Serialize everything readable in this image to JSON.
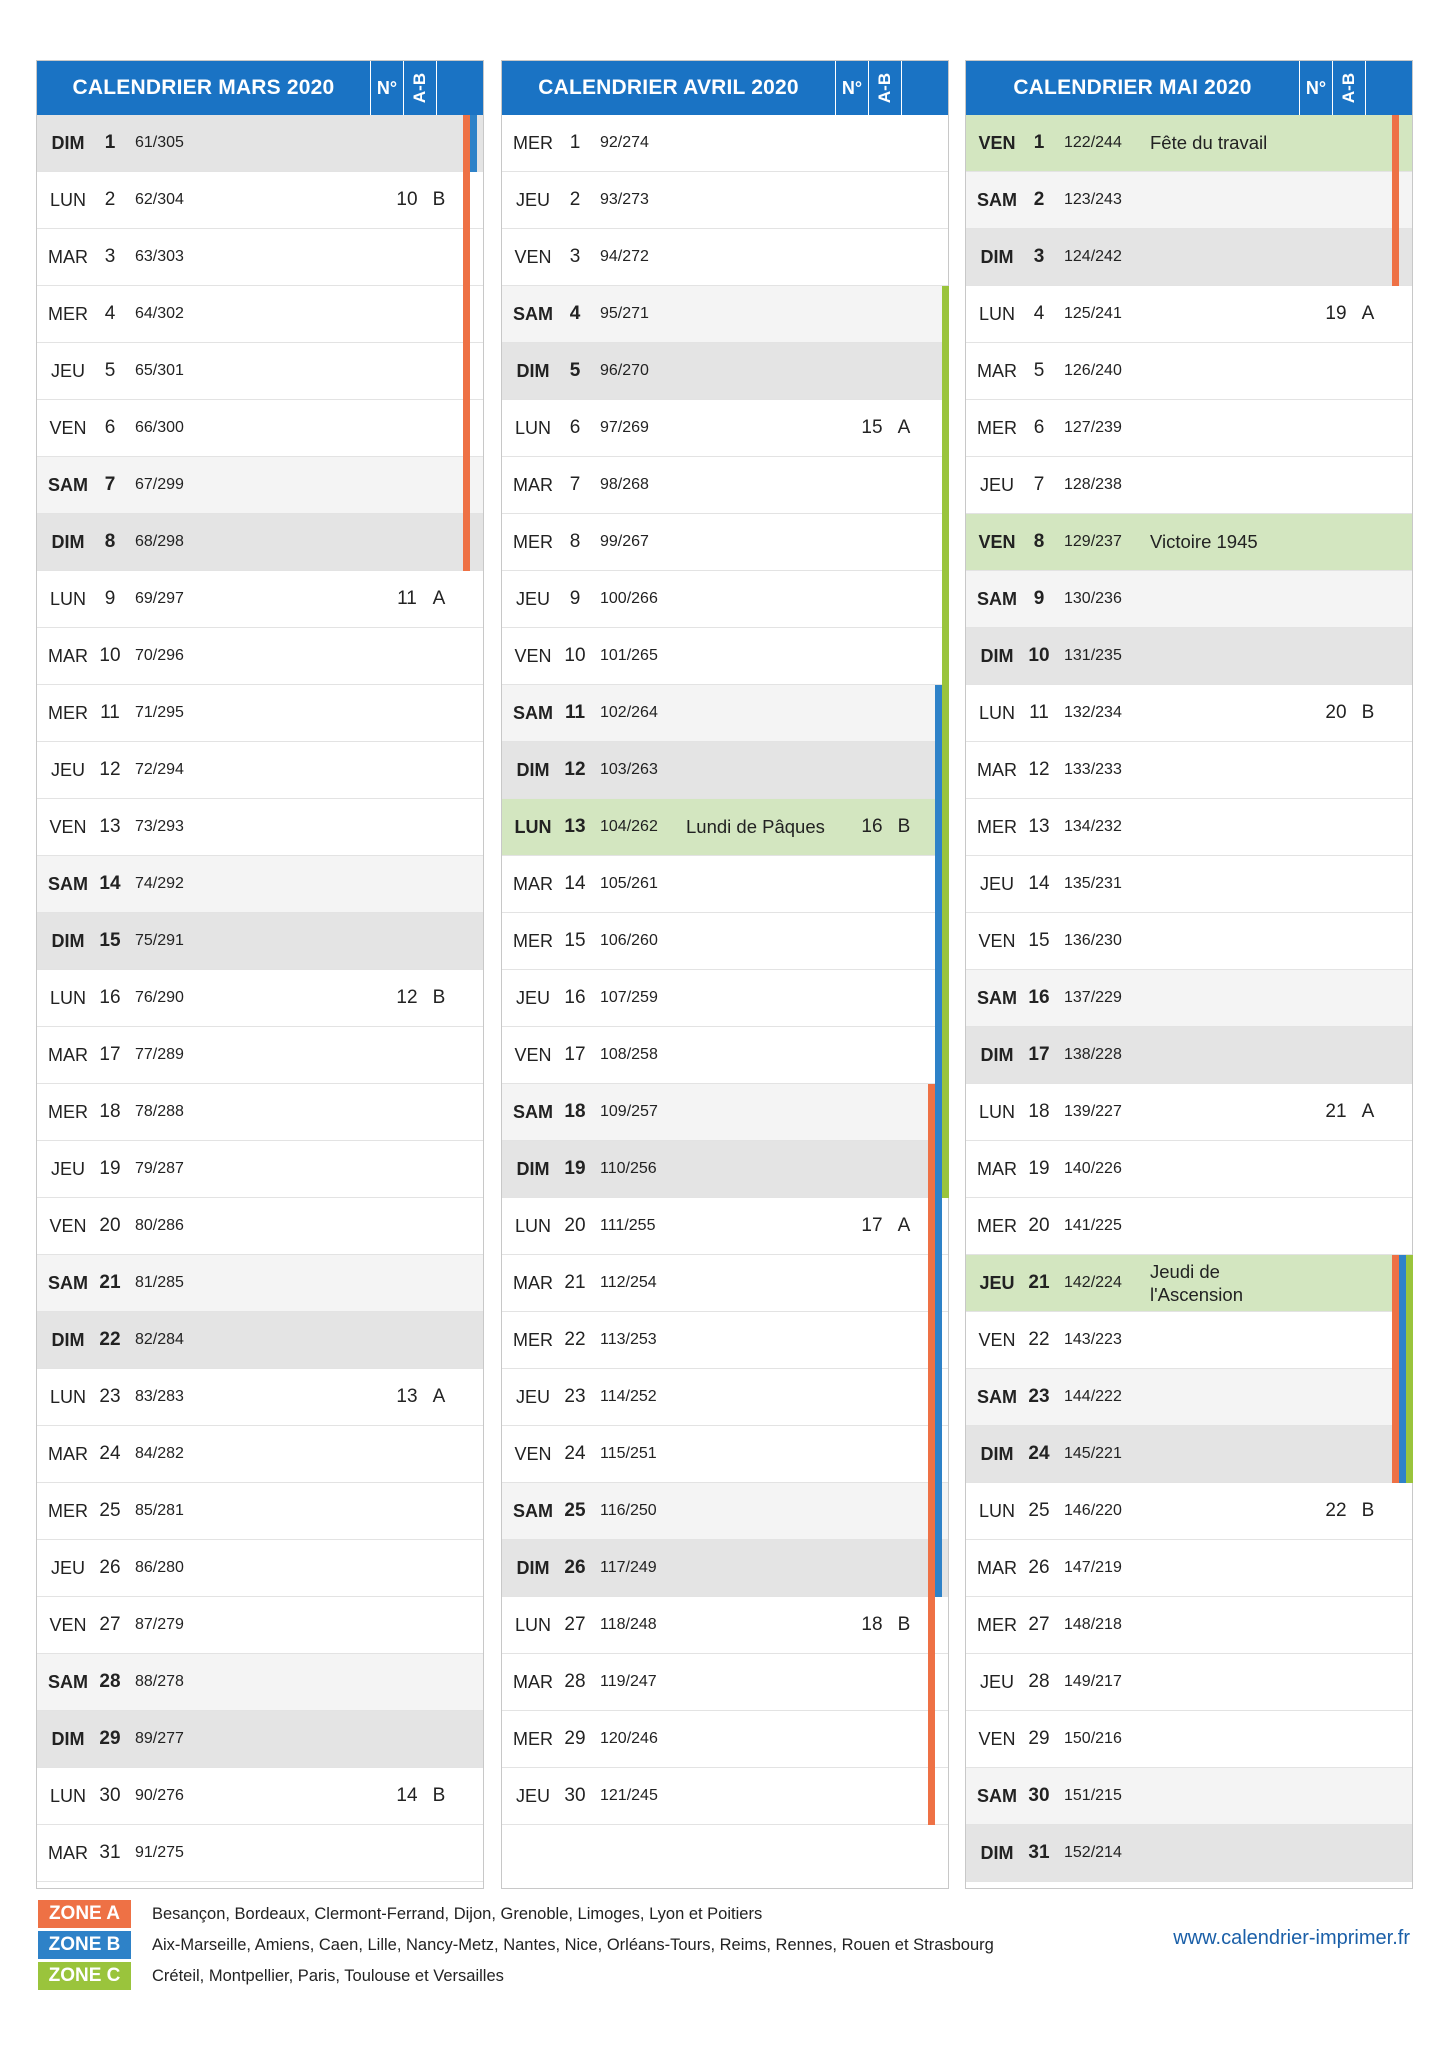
{
  "colors": {
    "header": "#1a73c4",
    "zone_a": "#ee7145",
    "zone_b": "#2e82c8",
    "zone_c": "#9ac43c",
    "holiday_bg": "#d3e6c0"
  },
  "header_no_label": "N°",
  "header_ab_label": "A-B",
  "months": [
    {
      "title": "CALENDRIER MARS 2020",
      "days": [
        {
          "dn": "DIM",
          "d": "1",
          "yd": "61/305",
          "zones": [
            "A",
            "B"
          ]
        },
        {
          "dn": "LUN",
          "d": "2",
          "yd": "62/304",
          "wk": "10",
          "ab": "B",
          "zones": [
            "A"
          ]
        },
        {
          "dn": "MAR",
          "d": "3",
          "yd": "63/303",
          "zones": [
            "A"
          ]
        },
        {
          "dn": "MER",
          "d": "4",
          "yd": "64/302",
          "zones": [
            "A"
          ]
        },
        {
          "dn": "JEU",
          "d": "5",
          "yd": "65/301",
          "zones": [
            "A"
          ]
        },
        {
          "dn": "VEN",
          "d": "6",
          "yd": "66/300",
          "zones": [
            "A"
          ]
        },
        {
          "dn": "SAM",
          "d": "7",
          "yd": "67/299",
          "zones": [
            "A"
          ]
        },
        {
          "dn": "DIM",
          "d": "8",
          "yd": "68/298",
          "zones": [
            "A"
          ]
        },
        {
          "dn": "LUN",
          "d": "9",
          "yd": "69/297",
          "wk": "11",
          "ab": "A"
        },
        {
          "dn": "MAR",
          "d": "10",
          "yd": "70/296"
        },
        {
          "dn": "MER",
          "d": "11",
          "yd": "71/295"
        },
        {
          "dn": "JEU",
          "d": "12",
          "yd": "72/294"
        },
        {
          "dn": "VEN",
          "d": "13",
          "yd": "73/293"
        },
        {
          "dn": "SAM",
          "d": "14",
          "yd": "74/292"
        },
        {
          "dn": "DIM",
          "d": "15",
          "yd": "75/291"
        },
        {
          "dn": "LUN",
          "d": "16",
          "yd": "76/290",
          "wk": "12",
          "ab": "B"
        },
        {
          "dn": "MAR",
          "d": "17",
          "yd": "77/289"
        },
        {
          "dn": "MER",
          "d": "18",
          "yd": "78/288"
        },
        {
          "dn": "JEU",
          "d": "19",
          "yd": "79/287"
        },
        {
          "dn": "VEN",
          "d": "20",
          "yd": "80/286"
        },
        {
          "dn": "SAM",
          "d": "21",
          "yd": "81/285"
        },
        {
          "dn": "DIM",
          "d": "22",
          "yd": "82/284"
        },
        {
          "dn": "LUN",
          "d": "23",
          "yd": "83/283",
          "wk": "13",
          "ab": "A"
        },
        {
          "dn": "MAR",
          "d": "24",
          "yd": "84/282"
        },
        {
          "dn": "MER",
          "d": "25",
          "yd": "85/281"
        },
        {
          "dn": "JEU",
          "d": "26",
          "yd": "86/280"
        },
        {
          "dn": "VEN",
          "d": "27",
          "yd": "87/279"
        },
        {
          "dn": "SAM",
          "d": "28",
          "yd": "88/278"
        },
        {
          "dn": "DIM",
          "d": "29",
          "yd": "89/277"
        },
        {
          "dn": "LUN",
          "d": "30",
          "yd": "90/276",
          "wk": "14",
          "ab": "B"
        },
        {
          "dn": "MAR",
          "d": "31",
          "yd": "91/275"
        }
      ]
    },
    {
      "title": "CALENDRIER AVRIL 2020",
      "days": [
        {
          "dn": "MER",
          "d": "1",
          "yd": "92/274"
        },
        {
          "dn": "JEU",
          "d": "2",
          "yd": "93/273"
        },
        {
          "dn": "VEN",
          "d": "3",
          "yd": "94/272"
        },
        {
          "dn": "SAM",
          "d": "4",
          "yd": "95/271",
          "zones": [
            "C"
          ]
        },
        {
          "dn": "DIM",
          "d": "5",
          "yd": "96/270",
          "zones": [
            "C"
          ]
        },
        {
          "dn": "LUN",
          "d": "6",
          "yd": "97/269",
          "wk": "15",
          "ab": "A",
          "zones": [
            "C"
          ]
        },
        {
          "dn": "MAR",
          "d": "7",
          "yd": "98/268",
          "zones": [
            "C"
          ]
        },
        {
          "dn": "MER",
          "d": "8",
          "yd": "99/267",
          "zones": [
            "C"
          ]
        },
        {
          "dn": "JEU",
          "d": "9",
          "yd": "100/266",
          "zones": [
            "C"
          ]
        },
        {
          "dn": "VEN",
          "d": "10",
          "yd": "101/265",
          "zones": [
            "C"
          ]
        },
        {
          "dn": "SAM",
          "d": "11",
          "yd": "102/264",
          "zones": [
            "B",
            "C"
          ]
        },
        {
          "dn": "DIM",
          "d": "12",
          "yd": "103/263",
          "zones": [
            "B",
            "C"
          ]
        },
        {
          "dn": "LUN",
          "d": "13",
          "yd": "104/262",
          "hol": "Lundi de Pâques",
          "wk": "16",
          "ab": "B",
          "zones": [
            "B",
            "C"
          ]
        },
        {
          "dn": "MAR",
          "d": "14",
          "yd": "105/261",
          "zones": [
            "B",
            "C"
          ]
        },
        {
          "dn": "MER",
          "d": "15",
          "yd": "106/260",
          "zones": [
            "B",
            "C"
          ]
        },
        {
          "dn": "JEU",
          "d": "16",
          "yd": "107/259",
          "zones": [
            "B",
            "C"
          ]
        },
        {
          "dn": "VEN",
          "d": "17",
          "yd": "108/258",
          "zones": [
            "B",
            "C"
          ]
        },
        {
          "dn": "SAM",
          "d": "18",
          "yd": "109/257",
          "zones": [
            "A",
            "B",
            "C"
          ]
        },
        {
          "dn": "DIM",
          "d": "19",
          "yd": "110/256",
          "zones": [
            "A",
            "B",
            "C"
          ]
        },
        {
          "dn": "LUN",
          "d": "20",
          "yd": "111/255",
          "wk": "17",
          "ab": "A",
          "zones": [
            "A",
            "B"
          ]
        },
        {
          "dn": "MAR",
          "d": "21",
          "yd": "112/254",
          "zones": [
            "A",
            "B"
          ]
        },
        {
          "dn": "MER",
          "d": "22",
          "yd": "113/253",
          "zones": [
            "A",
            "B"
          ]
        },
        {
          "dn": "JEU",
          "d": "23",
          "yd": "114/252",
          "zones": [
            "A",
            "B"
          ]
        },
        {
          "dn": "VEN",
          "d": "24",
          "yd": "115/251",
          "zones": [
            "A",
            "B"
          ]
        },
        {
          "dn": "SAM",
          "d": "25",
          "yd": "116/250",
          "zones": [
            "A",
            "B"
          ]
        },
        {
          "dn": "DIM",
          "d": "26",
          "yd": "117/249",
          "zones": [
            "A",
            "B"
          ]
        },
        {
          "dn": "LUN",
          "d": "27",
          "yd": "118/248",
          "wk": "18",
          "ab": "B",
          "zones": [
            "A"
          ]
        },
        {
          "dn": "MAR",
          "d": "28",
          "yd": "119/247",
          "zones": [
            "A"
          ]
        },
        {
          "dn": "MER",
          "d": "29",
          "yd": "120/246",
          "zones": [
            "A"
          ]
        },
        {
          "dn": "JEU",
          "d": "30",
          "yd": "121/245",
          "zones": [
            "A"
          ]
        }
      ]
    },
    {
      "title": "CALENDRIER MAI 2020",
      "days": [
        {
          "dn": "VEN",
          "d": "1",
          "yd": "122/244",
          "hol": "Fête du travail",
          "zones": [
            "A"
          ]
        },
        {
          "dn": "SAM",
          "d": "2",
          "yd": "123/243",
          "zones": [
            "A"
          ]
        },
        {
          "dn": "DIM",
          "d": "3",
          "yd": "124/242",
          "zones": [
            "A"
          ]
        },
        {
          "dn": "LUN",
          "d": "4",
          "yd": "125/241",
          "wk": "19",
          "ab": "A"
        },
        {
          "dn": "MAR",
          "d": "5",
          "yd": "126/240"
        },
        {
          "dn": "MER",
          "d": "6",
          "yd": "127/239"
        },
        {
          "dn": "JEU",
          "d": "7",
          "yd": "128/238"
        },
        {
          "dn": "VEN",
          "d": "8",
          "yd": "129/237",
          "hol": "Victoire 1945"
        },
        {
          "dn": "SAM",
          "d": "9",
          "yd": "130/236"
        },
        {
          "dn": "DIM",
          "d": "10",
          "yd": "131/235"
        },
        {
          "dn": "LUN",
          "d": "11",
          "yd": "132/234",
          "wk": "20",
          "ab": "B"
        },
        {
          "dn": "MAR",
          "d": "12",
          "yd": "133/233"
        },
        {
          "dn": "MER",
          "d": "13",
          "yd": "134/232"
        },
        {
          "dn": "JEU",
          "d": "14",
          "yd": "135/231"
        },
        {
          "dn": "VEN",
          "d": "15",
          "yd": "136/230"
        },
        {
          "dn": "SAM",
          "d": "16",
          "yd": "137/229"
        },
        {
          "dn": "DIM",
          "d": "17",
          "yd": "138/228"
        },
        {
          "dn": "LUN",
          "d": "18",
          "yd": "139/227",
          "wk": "21",
          "ab": "A"
        },
        {
          "dn": "MAR",
          "d": "19",
          "yd": "140/226"
        },
        {
          "dn": "MER",
          "d": "20",
          "yd": "141/225"
        },
        {
          "dn": "JEU",
          "d": "21",
          "yd": "142/224",
          "hol": "Jeudi de l'Ascension",
          "zones": [
            "A",
            "B",
            "C"
          ]
        },
        {
          "dn": "VEN",
          "d": "22",
          "yd": "143/223",
          "zones": [
            "A",
            "B",
            "C"
          ]
        },
        {
          "dn": "SAM",
          "d": "23",
          "yd": "144/222",
          "zones": [
            "A",
            "B",
            "C"
          ]
        },
        {
          "dn": "DIM",
          "d": "24",
          "yd": "145/221",
          "zones": [
            "A",
            "B",
            "C"
          ]
        },
        {
          "dn": "LUN",
          "d": "25",
          "yd": "146/220",
          "wk": "22",
          "ab": "B"
        },
        {
          "dn": "MAR",
          "d": "26",
          "yd": "147/219"
        },
        {
          "dn": "MER",
          "d": "27",
          "yd": "148/218"
        },
        {
          "dn": "JEU",
          "d": "28",
          "yd": "149/217"
        },
        {
          "dn": "VEN",
          "d": "29",
          "yd": "150/216"
        },
        {
          "dn": "SAM",
          "d": "30",
          "yd": "151/215"
        },
        {
          "dn": "DIM",
          "d": "31",
          "yd": "152/214"
        }
      ]
    }
  ],
  "legend": [
    {
      "zone": "A",
      "label": "ZONE A",
      "cities": "Besançon, Bordeaux, Clermont-Ferrand, Dijon, Grenoble, Limoges, Lyon et Poitiers"
    },
    {
      "zone": "B",
      "label": "ZONE B",
      "cities": "Aix-Marseille, Amiens, Caen, Lille, Nancy-Metz, Nantes, Nice, Orléans-Tours, Reims, Rennes, Rouen et Strasbourg"
    },
    {
      "zone": "C",
      "label": "ZONE C",
      "cities": "Créteil, Montpellier, Paris, Toulouse et Versailles"
    }
  ],
  "website": "www.calendrier-imprimer.fr"
}
